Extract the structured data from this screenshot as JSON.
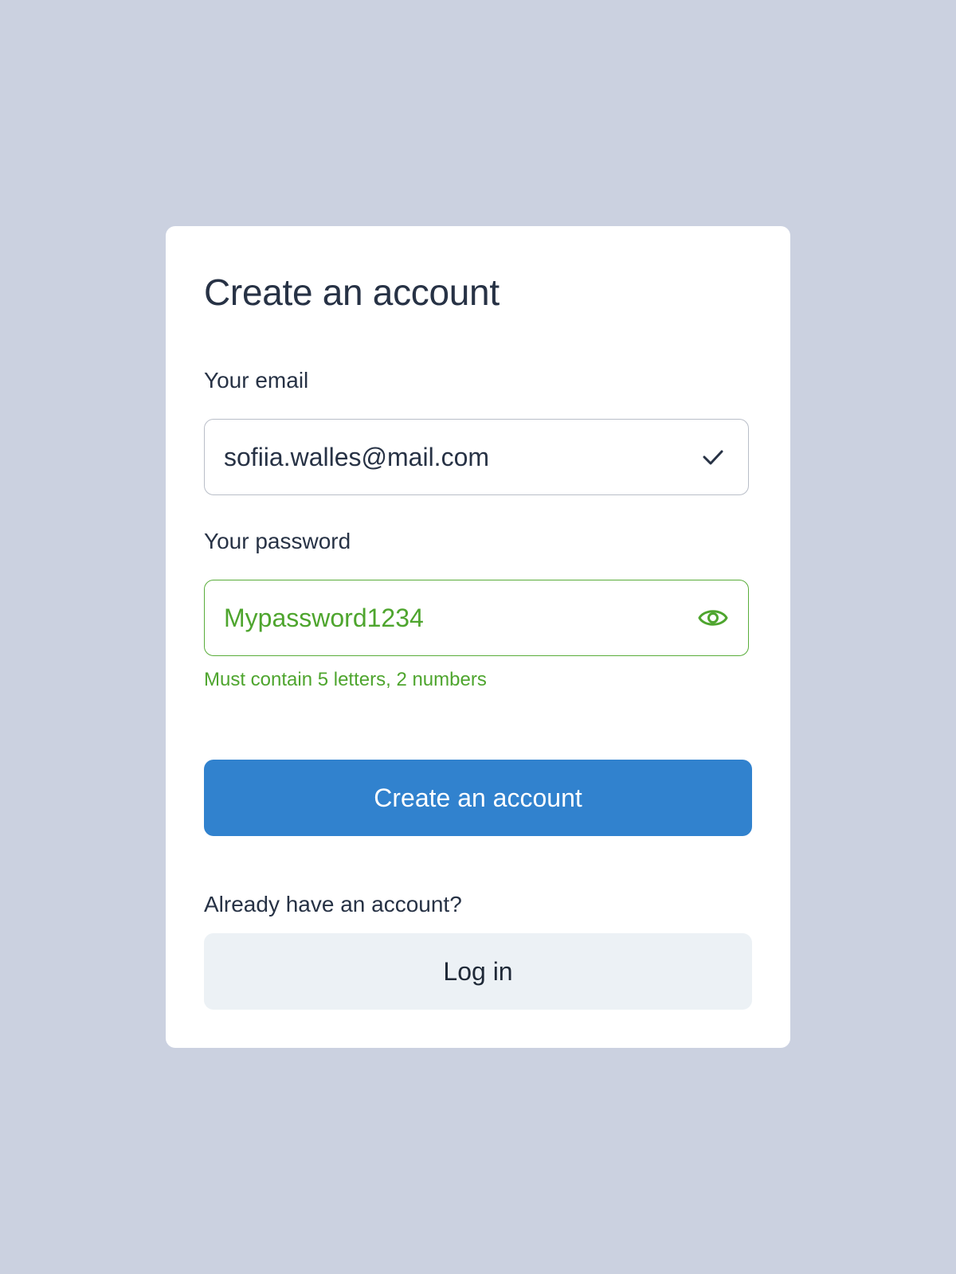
{
  "colors": {
    "background": "#cbd1e0",
    "card": "#ffffff",
    "text": "#273245",
    "success": "#4ea52e",
    "primary": "#3182ce",
    "secondary": "#ecf1f5"
  },
  "form": {
    "title": "Create an account",
    "email": {
      "label": "Your email",
      "value": "sofiia.walles@mail.com",
      "status_icon": "check-icon"
    },
    "password": {
      "label": "Your password",
      "value": "Mypassword1234",
      "toggle_icon": "eye-icon",
      "hint": "Must contain 5 letters, 2 numbers"
    },
    "submit_label": "Create an account",
    "login_prompt": "Already have an account?",
    "login_label": "Log in"
  }
}
